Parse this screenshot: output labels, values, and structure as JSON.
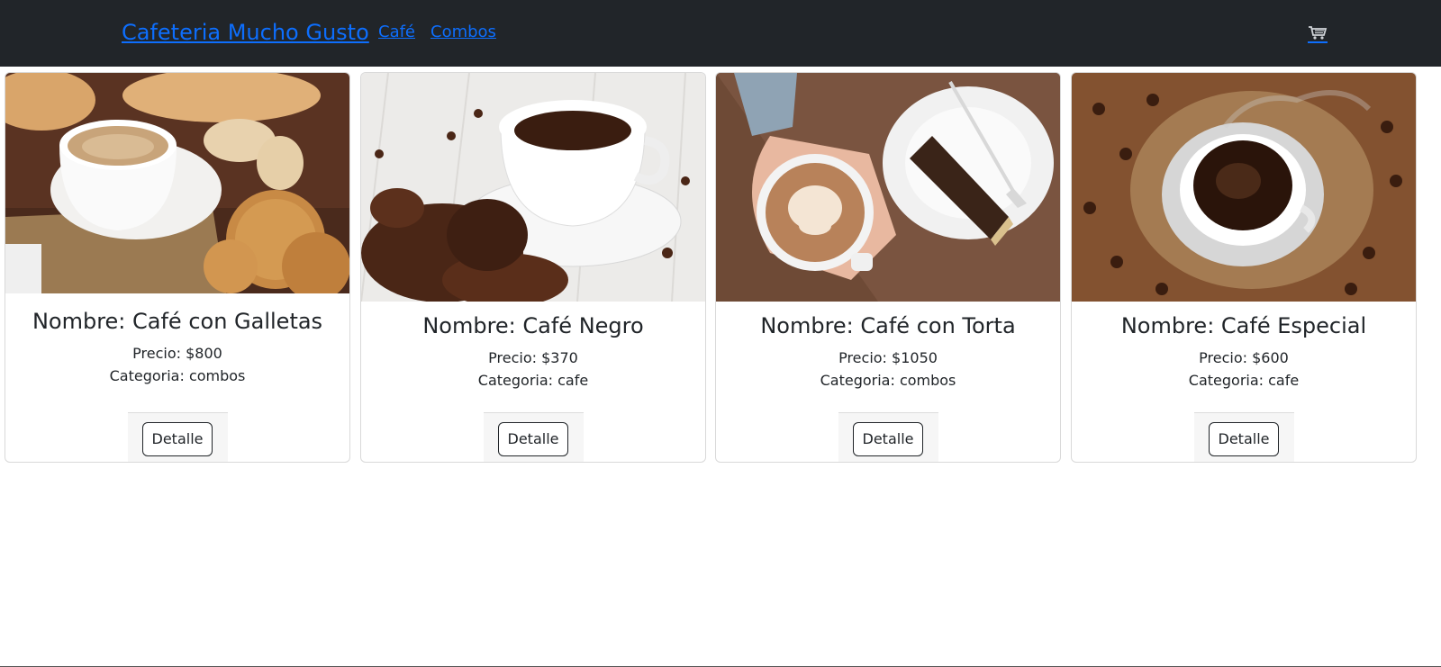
{
  "navbar": {
    "brand": "Cafeteria Mucho Gusto",
    "links": [
      "Café",
      "Combos"
    ],
    "cart_icon": "cart-icon",
    "background": "#212529",
    "link_color": "#0d6efd"
  },
  "products": [
    {
      "name": "Nombre: Café con Galletas",
      "price": "Precio: $800",
      "category": "Categoria: combos",
      "button": "Detalle",
      "image": "coffee-with-cookies-photo"
    },
    {
      "name": "Nombre: Café Negro",
      "price": "Precio: $370",
      "category": "Categoria: cafe",
      "button": "Detalle",
      "image": "black-coffee-beans-photo"
    },
    {
      "name": "Nombre: Café con Torta",
      "price": "Precio: $1050",
      "category": "Categoria: combos",
      "button": "Detalle",
      "image": "latte-and-cake-photo"
    },
    {
      "name": "Nombre: Café Especial",
      "price": "Precio: $600",
      "category": "Categoria: cafe",
      "button": "Detalle",
      "image": "special-coffee-photo"
    }
  ]
}
